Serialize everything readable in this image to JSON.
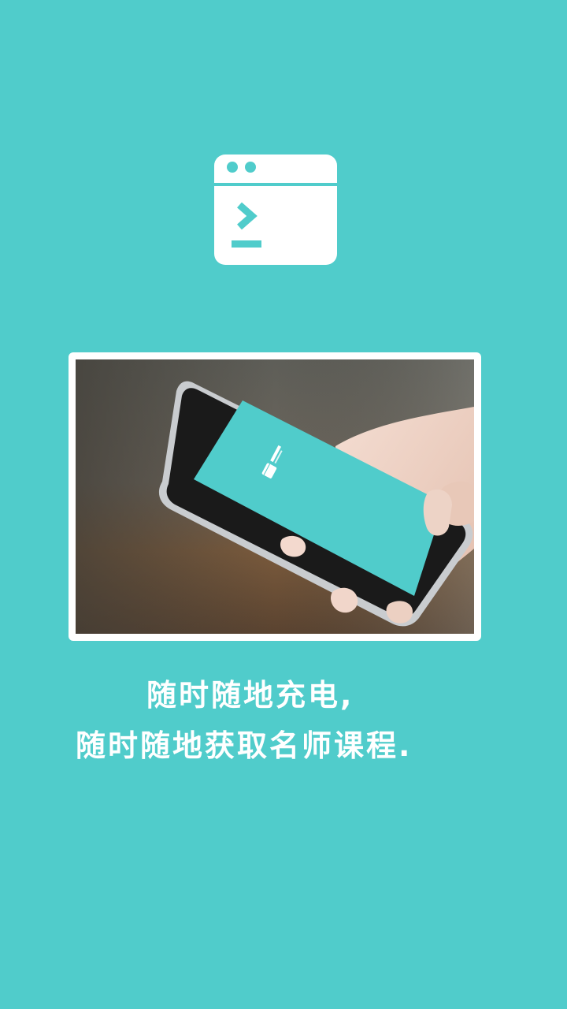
{
  "splash": {
    "logo_icon": "terminal-window-icon",
    "photo_icon": "hand-holding-phone-photo",
    "caption_line1": "随时随地充电,",
    "caption_line2": "随时随地获取名师课程."
  },
  "colors": {
    "background": "#50cccb",
    "logo": "#ffffff",
    "frame": "#ffffff",
    "caption_text": "#ffffff"
  }
}
